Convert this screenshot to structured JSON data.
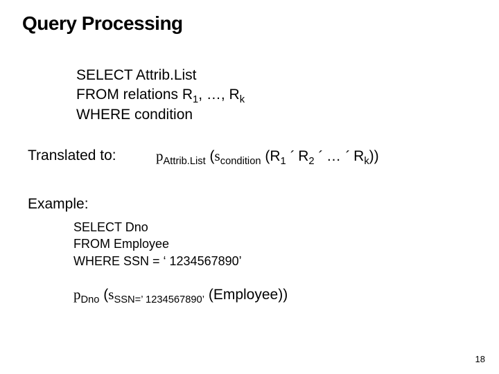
{
  "title": "Query Processing",
  "sql": {
    "line1": "SELECT Attrib.List",
    "line2_prefix": "FROM relations R",
    "line2_sub1": "1",
    "line2_mid": ", …, R",
    "line2_sub2": "k",
    "line3": "WHERE condition"
  },
  "translated_label": "Translated to:",
  "formula1": {
    "pi": "p",
    "pi_sub": "Attrib.List",
    "open": " (",
    "sigma": "s",
    "sigma_sub": "condition",
    "open2": " (R",
    "s1": "1",
    "x": " ´ ",
    "r2": "R",
    "s2": "2",
    "x2": " ´ ",
    "dots": " … ",
    "x3": " ´ ",
    "rk": "R",
    "sk": "k",
    "close": "))"
  },
  "example_label": "Example:",
  "example_sql": {
    "line1": "SELECT Dno",
    "line2": "FROM Employee",
    "line3": "WHERE SSN = ‘ 1234567890’"
  },
  "formula2": {
    "pi": "p",
    "pi_sub": "Dno",
    "open": " (",
    "sigma": "s",
    "sigma_sub": "SSN=’ 1234567890’",
    "rest": " (Employee))"
  },
  "page_number": "18"
}
